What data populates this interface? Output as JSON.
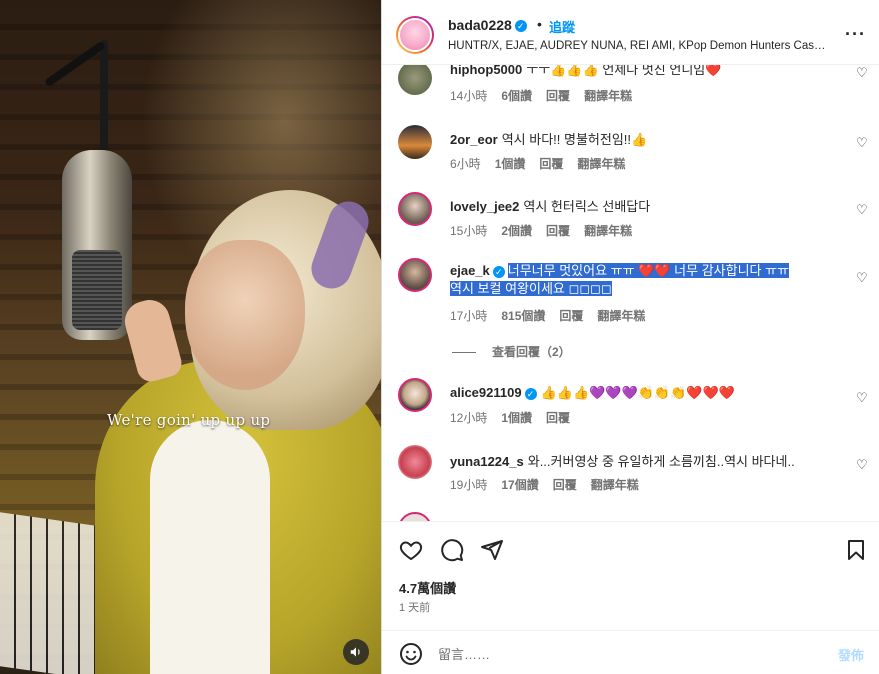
{
  "video": {
    "caption": "We're goin' up up up",
    "sound_icon": "speaker-icon"
  },
  "header": {
    "username": "bada0228",
    "dot": "•",
    "follow_label": "追蹤",
    "subtitle": "HUNTR/X, EJAE, AUDREY NUNA, REI AMI, KPop Demon Hunters Cast…",
    "more_icon": "more-options-icon"
  },
  "comments": [
    {
      "username": "hiphop5000",
      "text": "ㅜㅜ👍👍👍 언제나 멋진 언니임❤️",
      "time": "14小時",
      "likes": "6個讚",
      "reply": "回覆",
      "translate": "翻譯年糕"
    },
    {
      "username": "2or_eor",
      "text": "역시 바다!! 명불허전임!!👍",
      "time": "6小時",
      "likes": "1個讚",
      "reply": "回覆",
      "translate": "翻譯年糕"
    },
    {
      "username": "lovely_jee2",
      "text": "역시 헌터릭스 선배답다",
      "time": "15小時",
      "likes": "2個讚",
      "reply": "回覆",
      "translate": "翻譯年糕"
    },
    {
      "username": "ejae_k",
      "text_line1": "너무너무 멋있어요 ㅠㅠ ❤️❤️ 너무 감사합니다 ㅠㅠ",
      "text_line2": "역시 보컬 여왕이세요 ◻◻◻◻",
      "time": "17小時",
      "likes": "815個讚",
      "reply": "回覆",
      "translate": "翻譯年糕"
    },
    {
      "username": "alice921109",
      "text": "👍👍👍💜💜💜👏👏👏❤️❤️❤️",
      "time": "12小時",
      "likes": "1個讚",
      "reply": "回覆"
    },
    {
      "username": "yuna1224_s",
      "text": "와...커버영상 중 유일하게 소름끼침..역시 바다네..",
      "time": "19小時",
      "likes": "17個讚",
      "reply": "回覆",
      "translate": "翻譯年糕"
    }
  ],
  "view_replies": "查看回覆（2）",
  "actions": {
    "likes_count": "4.7萬個讚",
    "posted_time": "1 天前"
  },
  "add_comment": {
    "placeholder": "留言……",
    "post_label": "發佈"
  },
  "colors": {
    "accent": "#0095f6",
    "highlight": "#2f6bd0",
    "heart": "#ed4956"
  }
}
